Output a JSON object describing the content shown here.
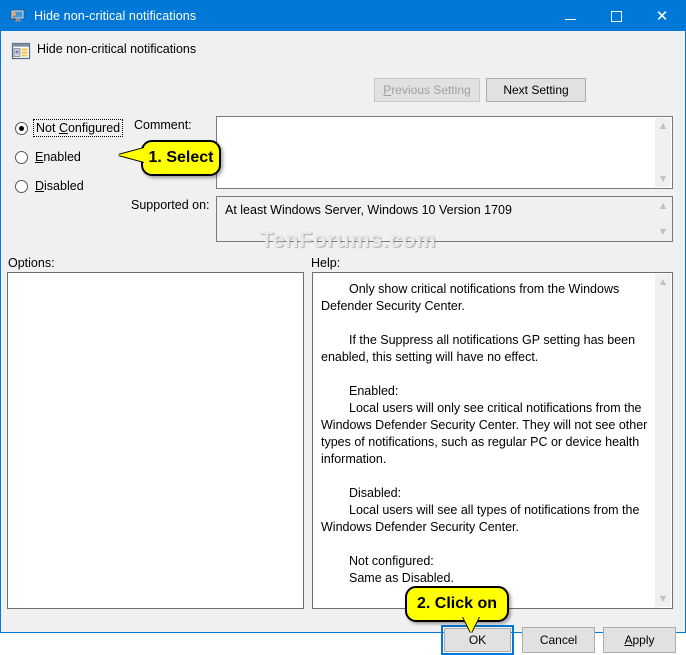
{
  "window": {
    "title": "Hide non-critical notifications",
    "icon": "policy-setting-icon",
    "minimize_label": "Minimize",
    "maximize_label": "Maximize",
    "close_label": "Close"
  },
  "header": {
    "setting_name": "Hide non-critical notifications",
    "icon": "group-policy-setting-icon"
  },
  "nav": {
    "previous_setting": "Previous Setting",
    "previous_mnemonic": "P",
    "previous_disabled": true,
    "next_setting": "Next Setting"
  },
  "state": {
    "options": [
      {
        "label": "Not Configured",
        "mnemonic": "C",
        "checked": true,
        "focused": true
      },
      {
        "label": "Enabled",
        "mnemonic": "E",
        "checked": false,
        "focused": false
      },
      {
        "label": "Disabled",
        "mnemonic": "D",
        "checked": false,
        "focused": false
      }
    ]
  },
  "fields": {
    "comment_label": "Comment:",
    "comment_value": "",
    "supported_label": "Supported on:",
    "supported_value": "At least Windows Server, Windows 10 Version 1709"
  },
  "panels": {
    "options_label": "Options:",
    "options_content": "",
    "help_label": "Help:",
    "help_paragraphs": [
      "Only show critical notifications from the Windows Defender Security Center.",
      "If the Suppress all notifications GP setting has been enabled, this setting will have no effect.",
      "Enabled:",
      "Local users will only see critical notifications from the Windows Defender Security Center. They will not see other types of notifications, such as regular PC or device health information.",
      "Disabled:",
      "Local users will see all types of notifications from the Windows Defender Security Center.",
      "Not configured:",
      "Same as Disabled."
    ]
  },
  "footer": {
    "ok": "OK",
    "cancel": "Cancel",
    "apply": "Apply",
    "apply_mnemonic": "A"
  },
  "annotations": {
    "callout_1": "1. Select",
    "callout_2": "2. Click on",
    "watermark": "TenForums.com"
  },
  "colors": {
    "accent": "#0078d7",
    "window_bg": "#f0f0f0",
    "callout_bg": "#ffff00"
  }
}
